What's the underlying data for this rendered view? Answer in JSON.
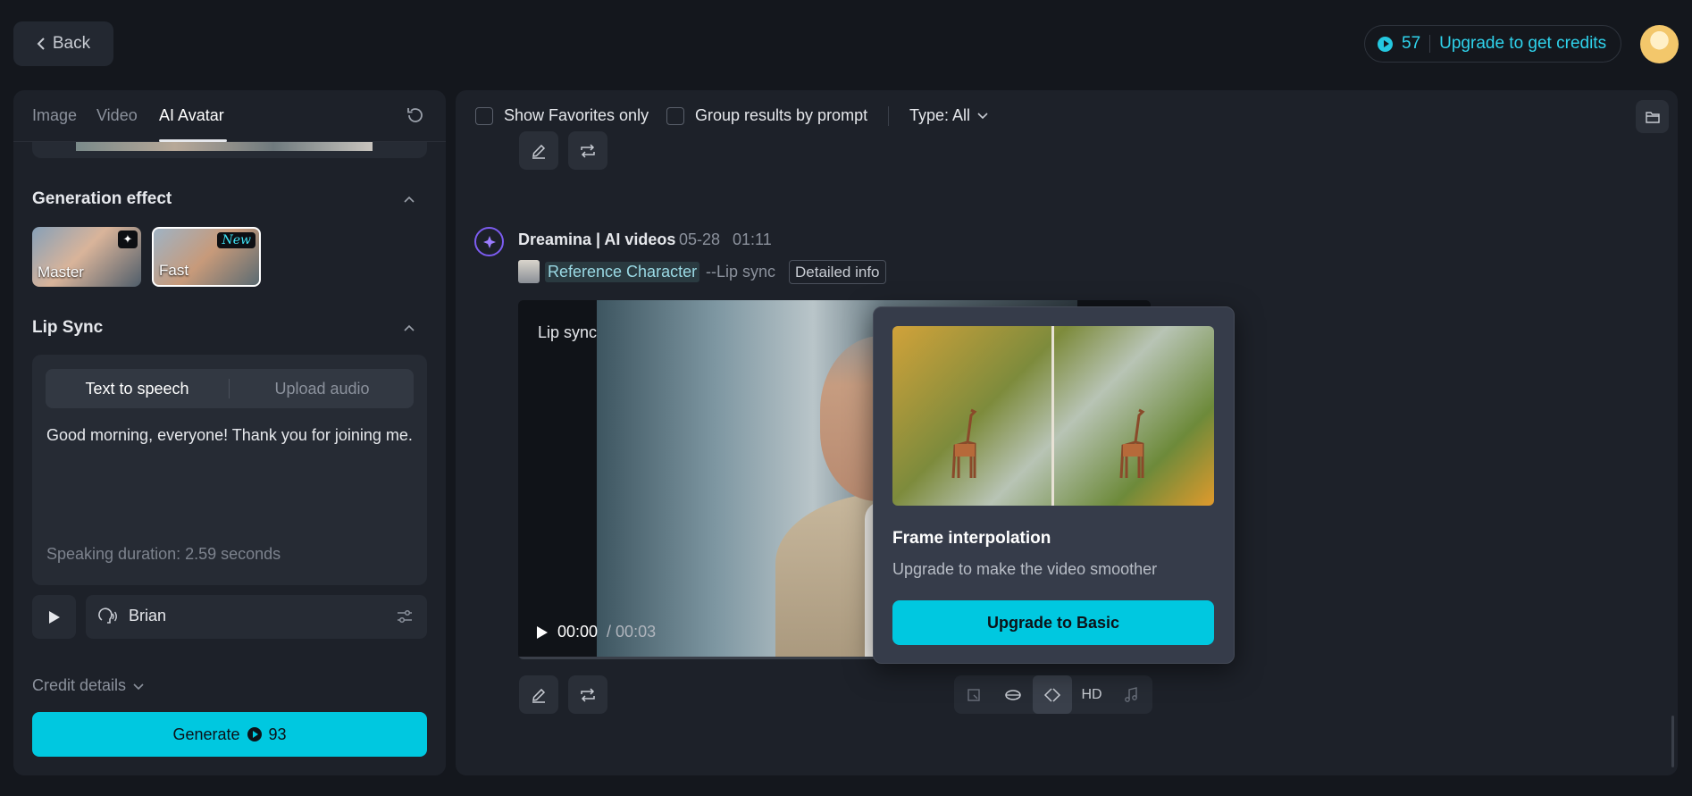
{
  "header": {
    "back_label": "Back",
    "credits": "57",
    "upgrade_label": "Upgrade to get credits"
  },
  "left_panel": {
    "tabs": [
      {
        "label": "Image"
      },
      {
        "label": "Video"
      },
      {
        "label": "AI Avatar"
      }
    ],
    "generation_effect": {
      "title": "Generation effect",
      "options": [
        {
          "label": "Master",
          "badge": "✦"
        },
        {
          "label": "Fast",
          "badge": "New"
        }
      ]
    },
    "lip_sync": {
      "title": "Lip Sync",
      "modes": [
        "Text to speech",
        "Upload audio"
      ],
      "text": "Good morning, everyone! Thank you for joining me.",
      "duration": "Speaking duration: 2.59 seconds",
      "voice": "Brian"
    },
    "credit_details": "Credit details",
    "generate": {
      "label": "Generate",
      "cost": "93"
    }
  },
  "right_panel": {
    "filters": {
      "favorites": "Show Favorites only",
      "group": "Group results by prompt",
      "type": "Type: All"
    },
    "item": {
      "author": "Dreamina | AI videos",
      "date": "05-28",
      "time": "01:11",
      "reference": "Reference Character",
      "mode": "--Lip sync",
      "detail": "Detailed info",
      "video_label": "Lip sync",
      "current_time": "00:00",
      "total_time": "/ 00:03",
      "toolbar_hd": "HD"
    }
  },
  "popover": {
    "title": "Frame interpolation",
    "subtitle": "Upgrade to make the video smoother",
    "button": "Upgrade to Basic"
  },
  "colors": {
    "accent": "#00c8e0",
    "background": "#14171d",
    "panel": "#1d2129"
  }
}
